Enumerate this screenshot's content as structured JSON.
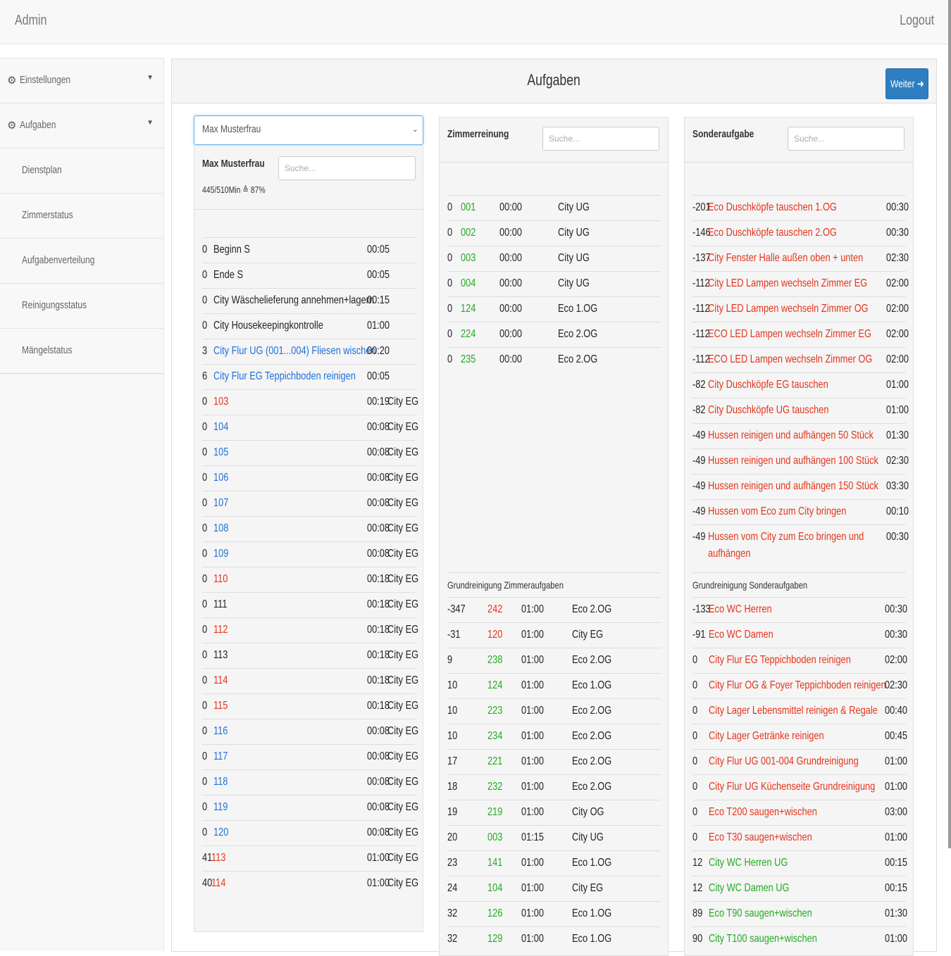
{
  "navbar": {
    "brand": "Admin",
    "logout": "Logout"
  },
  "sidebar": {
    "items": [
      {
        "label": "Einstellungen",
        "type": "parent"
      },
      {
        "label": "Aufgaben",
        "type": "parent"
      },
      {
        "label": "Dienstplan",
        "type": "child"
      },
      {
        "label": "Zimmerstatus",
        "type": "child"
      },
      {
        "label": "Aufgabenverteilung",
        "type": "child"
      },
      {
        "label": "Reinigungsstatus",
        "type": "child"
      },
      {
        "label": "Mängelstatus",
        "type": "child"
      }
    ]
  },
  "main": {
    "title": "Aufgaben",
    "next_button": "Weiter"
  },
  "staff": {
    "selected": "Max Musterfrau",
    "name": "Max Musterfrau",
    "search_placeholder": "Suche...",
    "workload": "445/510Min ≙ 87%",
    "tasks": [
      {
        "count": "0",
        "label": "Beginn S",
        "time": "00:05",
        "loc": "",
        "color": "dark"
      },
      {
        "count": "0",
        "label": "Ende S",
        "time": "00:05",
        "loc": "",
        "color": "dark"
      },
      {
        "count": "0",
        "label": "City Wäschelieferung annehmen+lagern",
        "time": "00:15",
        "loc": "",
        "color": "dark"
      },
      {
        "count": "0",
        "label": "City Housekeepingkontrolle",
        "time": "01:00",
        "loc": "",
        "color": "dark"
      },
      {
        "count": "3",
        "label": "City Flur UG (001...004) Fliesen wischen",
        "time": "00:20",
        "loc": "",
        "color": "blue"
      },
      {
        "count": "6",
        "label": "City Flur EG Teppichboden reinigen",
        "time": "00:05",
        "loc": "",
        "color": "blue"
      },
      {
        "count": "0",
        "label": "103",
        "time": "00:19",
        "loc": "City EG",
        "color": "red"
      },
      {
        "count": "0",
        "label": "104",
        "time": "00:08",
        "loc": "City EG",
        "color": "blue"
      },
      {
        "count": "0",
        "label": "105",
        "time": "00:08",
        "loc": "City EG",
        "color": "blue"
      },
      {
        "count": "0",
        "label": "106",
        "time": "00:08",
        "loc": "City EG",
        "color": "blue"
      },
      {
        "count": "0",
        "label": "107",
        "time": "00:08",
        "loc": "City EG",
        "color": "blue"
      },
      {
        "count": "0",
        "label": "108",
        "time": "00:08",
        "loc": "City EG",
        "color": "blue"
      },
      {
        "count": "0",
        "label": "109",
        "time": "00:08",
        "loc": "City EG",
        "color": "blue"
      },
      {
        "count": "0",
        "label": "110",
        "time": "00:18",
        "loc": "City EG",
        "color": "red"
      },
      {
        "count": "0",
        "label": "111",
        "time": "00:18",
        "loc": "City EG",
        "color": "dark"
      },
      {
        "count": "0",
        "label": "112",
        "time": "00:18",
        "loc": "City EG",
        "color": "red"
      },
      {
        "count": "0",
        "label": "113",
        "time": "00:18",
        "loc": "City EG",
        "color": "dark"
      },
      {
        "count": "0",
        "label": "114",
        "time": "00:18",
        "loc": "City EG",
        "color": "red"
      },
      {
        "count": "0",
        "label": "115",
        "time": "00:18",
        "loc": "City EG",
        "color": "red"
      },
      {
        "count": "0",
        "label": "116",
        "time": "00:08",
        "loc": "City EG",
        "color": "blue"
      },
      {
        "count": "0",
        "label": "117",
        "time": "00:08",
        "loc": "City EG",
        "color": "blue"
      },
      {
        "count": "0",
        "label": "118",
        "time": "00:08",
        "loc": "City EG",
        "color": "blue"
      },
      {
        "count": "0",
        "label": "119",
        "time": "00:08",
        "loc": "City EG",
        "color": "blue"
      },
      {
        "count": "0",
        "label": "120",
        "time": "00:08",
        "loc": "City EG",
        "color": "blue"
      },
      {
        "count": "41",
        "label": "113",
        "time": "01:00",
        "loc": "City EG",
        "color": "red"
      },
      {
        "count": "40",
        "label": "114",
        "time": "01:00",
        "loc": "City EG",
        "color": "red"
      }
    ]
  },
  "zimmer": {
    "title": "Zimmerreinung",
    "search_placeholder": "Suche...",
    "rooms": [
      {
        "count": "0",
        "room": "001",
        "time": "00:00",
        "loc": "City UG"
      },
      {
        "count": "0",
        "room": "002",
        "time": "00:00",
        "loc": "City UG"
      },
      {
        "count": "0",
        "room": "003",
        "time": "00:00",
        "loc": "City UG"
      },
      {
        "count": "0",
        "room": "004",
        "time": "00:00",
        "loc": "City UG"
      },
      {
        "count": "0",
        "room": "124",
        "time": "00:00",
        "loc": "Eco 1.OG"
      },
      {
        "count": "0",
        "room": "224",
        "time": "00:00",
        "loc": "Eco 2.OG"
      },
      {
        "count": "0",
        "room": "235",
        "time": "00:00",
        "loc": "Eco 2.OG"
      }
    ],
    "grund_title": "Grundreinigung Zimmeraufgaben",
    "grund": [
      {
        "count": "-347",
        "room": "242",
        "time": "01:00",
        "loc": "Eco 2.OG",
        "color": "red"
      },
      {
        "count": "-31",
        "room": "120",
        "time": "01:00",
        "loc": "City EG",
        "color": "red"
      },
      {
        "count": "9",
        "room": "238",
        "time": "01:00",
        "loc": "Eco 2.OG",
        "color": "green"
      },
      {
        "count": "10",
        "room": "124",
        "time": "01:00",
        "loc": "Eco 1.OG",
        "color": "green"
      },
      {
        "count": "10",
        "room": "223",
        "time": "01:00",
        "loc": "Eco 2.OG",
        "color": "green"
      },
      {
        "count": "10",
        "room": "234",
        "time": "01:00",
        "loc": "Eco 2.OG",
        "color": "green"
      },
      {
        "count": "17",
        "room": "221",
        "time": "01:00",
        "loc": "Eco 2.OG",
        "color": "green"
      },
      {
        "count": "18",
        "room": "232",
        "time": "01:00",
        "loc": "Eco 2.OG",
        "color": "green"
      },
      {
        "count": "19",
        "room": "219",
        "time": "01:00",
        "loc": "City OG",
        "color": "green"
      },
      {
        "count": "20",
        "room": "003",
        "time": "01:15",
        "loc": "City UG",
        "color": "green"
      },
      {
        "count": "23",
        "room": "141",
        "time": "01:00",
        "loc": "Eco 1.OG",
        "color": "green"
      },
      {
        "count": "24",
        "room": "104",
        "time": "01:00",
        "loc": "City EG",
        "color": "green"
      },
      {
        "count": "32",
        "room": "126",
        "time": "01:00",
        "loc": "Eco 1.OG",
        "color": "green"
      },
      {
        "count": "32",
        "room": "129",
        "time": "01:00",
        "loc": "Eco 1.OG",
        "color": "green"
      }
    ]
  },
  "sonder": {
    "title": "Sonderaufgabe",
    "search_placeholder": "Suche...",
    "tasks": [
      {
        "count": "-201",
        "label": "Eco Duschköpfe tauschen 1.OG",
        "time": "00:30"
      },
      {
        "count": "-146",
        "label": "Eco Duschköpfe tauschen 2.OG",
        "time": "00:30"
      },
      {
        "count": "-137",
        "label": "City Fenster Halle außen oben + unten",
        "time": "02:30"
      },
      {
        "count": "-112",
        "label": "City LED Lampen wechseln Zimmer EG",
        "time": "02:00"
      },
      {
        "count": "-112",
        "label": "City LED Lampen wechseln Zimmer OG",
        "time": "02:00"
      },
      {
        "count": "-112",
        "label": "ECO LED Lampen wechseln Zimmer EG",
        "time": "02:00"
      },
      {
        "count": "-112",
        "label": "ECO LED Lampen wechseln Zimmer OG",
        "time": "02:00"
      },
      {
        "count": "-82",
        "label": "City Duschköpfe EG tauschen",
        "time": "01:00"
      },
      {
        "count": "-82",
        "label": "City Duschköpfe UG tauschen",
        "time": "01:00"
      },
      {
        "count": "-49",
        "label": "Hussen reinigen und aufhängen 50 Stück",
        "time": "01:30"
      },
      {
        "count": "-49",
        "label": "Hussen reinigen und aufhängen 100 Stück",
        "time": "02:30"
      },
      {
        "count": "-49",
        "label": "Hussen reinigen und aufhängen 150 Stück",
        "time": "03:30"
      },
      {
        "count": "-49",
        "label": "Hussen vom Eco zum City bringen",
        "time": "00:10"
      },
      {
        "count": "-49",
        "label": "Hussen vom City zum Eco bringen und",
        "label2": "aufhängen",
        "time": "00:30"
      }
    ],
    "grund_title": "Grundreinigung Sonderaufgaben",
    "grund": [
      {
        "count": "-133",
        "label": "Eco WC Herren",
        "time": "00:30",
        "color": "red"
      },
      {
        "count": "-91",
        "label": "Eco WC Damen",
        "time": "00:30",
        "color": "red"
      },
      {
        "count": "0",
        "label": "City Flur EG Teppichboden reinigen",
        "time": "02:00",
        "color": "red"
      },
      {
        "count": "0",
        "label": "City Flur OG & Foyer Teppichboden reinigen",
        "time": "02:30",
        "color": "red"
      },
      {
        "count": "0",
        "label": "City Lager Lebensmittel reinigen & Regale",
        "time": "00:40",
        "color": "red"
      },
      {
        "count": "0",
        "label": "City Lager Getränke reinigen",
        "time": "00:45",
        "color": "red"
      },
      {
        "count": "0",
        "label": "City Flur UG 001-004 Grundreinigung",
        "time": "01:00",
        "color": "red"
      },
      {
        "count": "0",
        "label": "City Flur UG Küchenseite Grundreinigung",
        "time": "01:00",
        "color": "red"
      },
      {
        "count": "0",
        "label": "Eco T200 saugen+wischen",
        "time": "03:00",
        "color": "red"
      },
      {
        "count": "0",
        "label": "Eco T30 saugen+wischen",
        "time": "01:00",
        "color": "red"
      },
      {
        "count": "12",
        "label": "City WC Herren UG",
        "time": "00:15",
        "color": "green"
      },
      {
        "count": "12",
        "label": "City WC Damen UG",
        "time": "00:15",
        "color": "green"
      },
      {
        "count": "89",
        "label": "Eco T90 saugen+wischen",
        "time": "01:30",
        "color": "green"
      },
      {
        "count": "90",
        "label": "City T100 saugen+wischen",
        "time": "01:00",
        "color": "green"
      }
    ]
  }
}
